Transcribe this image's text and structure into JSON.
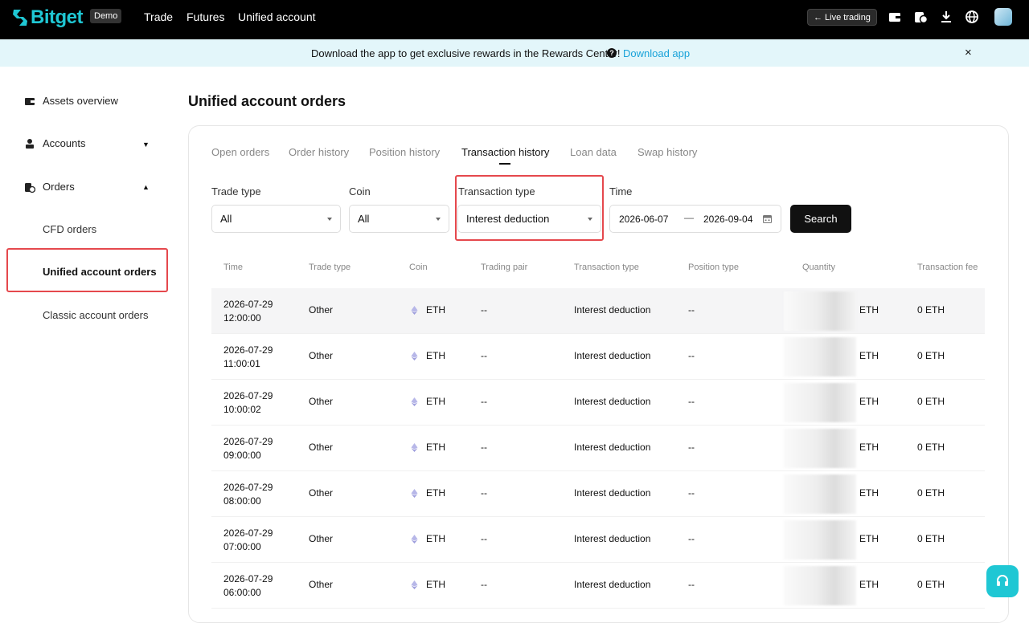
{
  "brand": {
    "name": "Bitget",
    "badge": "Demo",
    "accent": "#1fc7d4"
  },
  "nav": {
    "items": [
      "Trade",
      "Futures",
      "Unified account"
    ],
    "live_trading": "← Live trading"
  },
  "banner": {
    "text": "Download the app to get exclusive rewards in the Rewards Center!",
    "link": "Download app",
    "close": "×"
  },
  "sidebar": {
    "assets": "Assets overview",
    "accounts": "Accounts",
    "orders": "Orders",
    "sub": [
      "CFD orders",
      "Unified account orders",
      "Classic account orders"
    ],
    "active": "Unified account orders"
  },
  "page": {
    "title": "Unified account orders"
  },
  "tabs": [
    "Open orders",
    "Order history",
    "Position history",
    "Transaction history",
    "Loan data",
    "Swap history"
  ],
  "active_tab": "Transaction history",
  "filters": {
    "trade_type": {
      "label": "Trade type",
      "value": "All"
    },
    "coin": {
      "label": "Coin",
      "value": "All"
    },
    "transaction_type": {
      "label": "Transaction type",
      "value": "Interest deduction"
    },
    "time": {
      "label": "Time",
      "start": "2026-06-07",
      "sep": "—",
      "end": "2026-09-04"
    },
    "search": "Search"
  },
  "table": {
    "columns": [
      "Time",
      "Trade type",
      "Coin",
      "Trading pair",
      "Transaction type",
      "Position type",
      "Quantity",
      "Transaction fee"
    ],
    "rows": [
      {
        "date": "2026-07-29",
        "time": "12:00:00",
        "trade_type": "Other",
        "coin": "ETH",
        "pair": "--",
        "ttype": "Interest deduction",
        "ptype": "--",
        "qty_unit": "ETH",
        "fee": "0 ETH"
      },
      {
        "date": "2026-07-29",
        "time": "11:00:01",
        "trade_type": "Other",
        "coin": "ETH",
        "pair": "--",
        "ttype": "Interest deduction",
        "ptype": "--",
        "qty_unit": "ETH",
        "fee": "0 ETH"
      },
      {
        "date": "2026-07-29",
        "time": "10:00:02",
        "trade_type": "Other",
        "coin": "ETH",
        "pair": "--",
        "ttype": "Interest deduction",
        "ptype": "--",
        "qty_unit": "ETH",
        "fee": "0 ETH"
      },
      {
        "date": "2026-07-29",
        "time": "09:00:00",
        "trade_type": "Other",
        "coin": "ETH",
        "pair": "--",
        "ttype": "Interest deduction",
        "ptype": "--",
        "qty_unit": "ETH",
        "fee": "0 ETH"
      },
      {
        "date": "2026-07-29",
        "time": "08:00:00",
        "trade_type": "Other",
        "coin": "ETH",
        "pair": "--",
        "ttype": "Interest deduction",
        "ptype": "--",
        "qty_unit": "ETH",
        "fee": "0 ETH"
      },
      {
        "date": "2026-07-29",
        "time": "07:00:00",
        "trade_type": "Other",
        "coin": "ETH",
        "pair": "--",
        "ttype": "Interest deduction",
        "ptype": "--",
        "qty_unit": "ETH",
        "fee": "0 ETH"
      },
      {
        "date": "2026-07-29",
        "time": "06:00:00",
        "trade_type": "Other",
        "coin": "ETH",
        "pair": "--",
        "ttype": "Interest deduction",
        "ptype": "--",
        "qty_unit": "ETH",
        "fee": "0 ETH"
      }
    ]
  }
}
